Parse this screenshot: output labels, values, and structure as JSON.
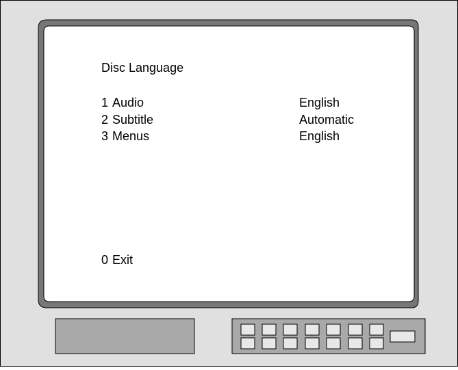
{
  "menu": {
    "title": "Disc Language",
    "items": [
      {
        "number": "1",
        "label": "Audio",
        "value": "English"
      },
      {
        "number": "2",
        "label": "Subtitle",
        "value": "Automatic"
      },
      {
        "number": "3",
        "label": "Menus",
        "value": "English"
      }
    ],
    "exit": {
      "number": "0",
      "label": "Exit"
    }
  },
  "colors": {
    "cabinet": "#e0e0e0",
    "screen_border": "#777777",
    "screen": "#ffffff",
    "outline": "#000000",
    "panel": "#a9a9a9",
    "button": "#e8e8e8"
  }
}
